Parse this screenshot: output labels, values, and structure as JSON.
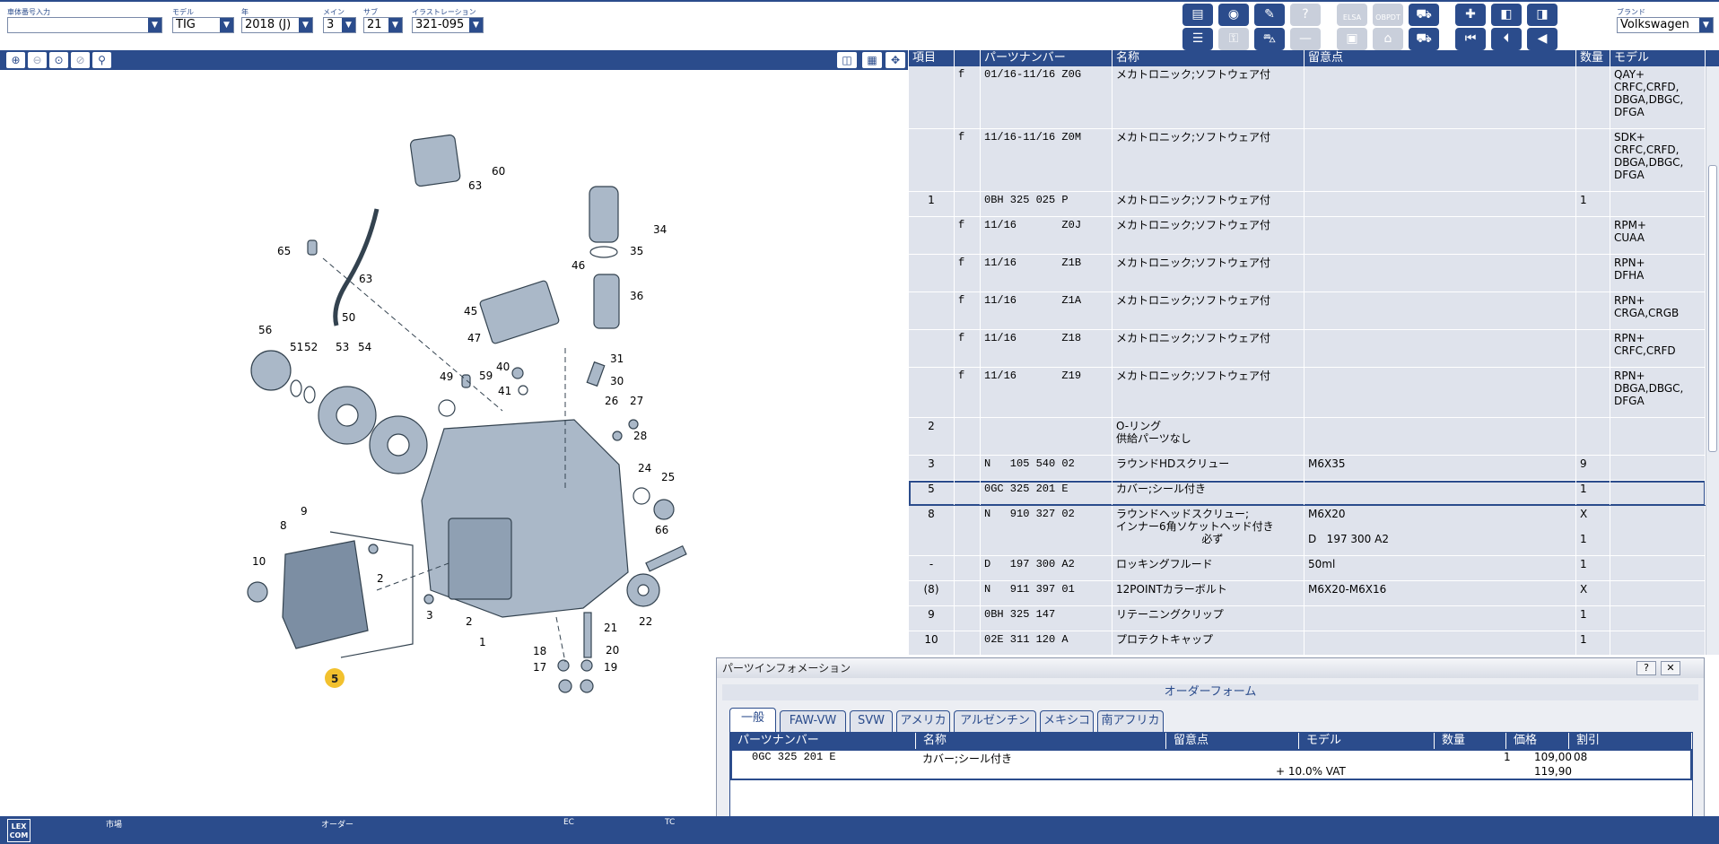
{
  "header": {
    "vin_label": "車体番号入力",
    "vin_value": "",
    "model_label": "モデル",
    "model_value": "TIG",
    "year_label": "年",
    "year_value": "2018 (J)",
    "main_label": "メイン",
    "main_value": "3",
    "sub_label": "サブ",
    "sub_value": "21",
    "illus_label": "イラストレーション",
    "illus_value": "321-095",
    "brand_label": "ブランド",
    "brand_value": "Volkswagen",
    "elsa_label": "ELSA",
    "obdt_label": "OBPDT"
  },
  "parts_table": {
    "columns": [
      "項目",
      "",
      "パーツナンバー",
      "名称",
      "留意点",
      "数量",
      "モデル"
    ],
    "rows": [
      {
        "item": "",
        "flag": "f",
        "part": "01/16-11/16 Z0G",
        "name": "メカトロニック;ソフトウェア付",
        "note": "",
        "qty": "",
        "model": "QAY+\nCRFC,CRFD,\nDBGA,DBGC,\nDFGA"
      },
      {
        "item": "",
        "flag": "f",
        "part": "11/16-11/16 Z0M",
        "name": "メカトロニック;ソフトウェア付",
        "note": "",
        "qty": "",
        "model": "SDK+\nCRFC,CRFD,\nDBGA,DBGC,\nDFGA"
      },
      {
        "item": "1",
        "flag": "",
        "part": "0BH 325 025 P",
        "name": "メカトロニック;ソフトウェア付",
        "note": "",
        "qty": "1",
        "model": ""
      },
      {
        "item": "",
        "flag": "f",
        "part": "11/16       Z0J",
        "name": "メカトロニック;ソフトウェア付",
        "note": "",
        "qty": "",
        "model": "RPM+\nCUAA"
      },
      {
        "item": "",
        "flag": "f",
        "part": "11/16       Z1B",
        "name": "メカトロニック;ソフトウェア付",
        "note": "",
        "qty": "",
        "model": "RPN+\nDFHA"
      },
      {
        "item": "",
        "flag": "f",
        "part": "11/16       Z1A",
        "name": "メカトロニック;ソフトウェア付",
        "note": "",
        "qty": "",
        "model": "RPN+\nCRGA,CRGB"
      },
      {
        "item": "",
        "flag": "f",
        "part": "11/16       Z18",
        "name": "メカトロニック;ソフトウェア付",
        "note": "",
        "qty": "",
        "model": "RPN+\nCRFC,CRFD"
      },
      {
        "item": "",
        "flag": "f",
        "part": "11/16       Z19",
        "name": "メカトロニック;ソフトウェア付",
        "note": "",
        "qty": "",
        "model": "RPN+\nDBGA,DBGC,\nDFGA"
      },
      {
        "item": "2",
        "flag": "",
        "part": "",
        "name": "O-リング\n供給パーツなし",
        "note": "",
        "qty": "",
        "model": ""
      },
      {
        "item": "3",
        "flag": "",
        "part": "N   105 540 02",
        "name": "ラウンドHDスクリュー",
        "note": "M6X35",
        "qty": "9",
        "model": ""
      },
      {
        "item": "5",
        "flag": "",
        "part": "0GC 325 201 E",
        "name": "カバー;シール付き",
        "note": "",
        "qty": "1",
        "model": ""
      },
      {
        "item": "8",
        "flag": "",
        "part": "N   910 327 02",
        "name": "ラウンドヘッドスクリュー;\nインナー6角ソケットヘッド付き\n                         必ず",
        "note": "M6X20\n\nD   197 300 A2",
        "qty": "X\n\n1",
        "model": ""
      },
      {
        "item": "-",
        "flag": "",
        "part": "D   197 300 A2",
        "name": "ロッキングフルード",
        "note": "50ml",
        "qty": "1",
        "model": ""
      },
      {
        "item": "(8)",
        "flag": "",
        "part": "N   911 397 01",
        "name": "12POINTカラーボルト",
        "note": "M6X20-M6X16",
        "qty": "X",
        "model": ""
      },
      {
        "item": "9",
        "flag": "",
        "part": "0BH 325 147",
        "name": "リテーニングクリップ",
        "note": "",
        "qty": "1",
        "model": ""
      },
      {
        "item": "10",
        "flag": "",
        "part": "02E 311 120 A",
        "name": "プロテクトキャップ",
        "note": "",
        "qty": "1",
        "model": ""
      }
    ]
  },
  "diagram": {
    "labels": [
      "60",
      "63",
      "65",
      "63",
      "34",
      "35",
      "36",
      "46",
      "45",
      "47",
      "56",
      "50",
      "51",
      "52",
      "53",
      "54",
      "49",
      "59",
      "40",
      "41",
      "31",
      "30",
      "26",
      "27",
      "28",
      "24",
      "25",
      "9",
      "8",
      "10",
      "2",
      "3",
      "66",
      "2",
      "1",
      "21",
      "22",
      "18",
      "20",
      "17",
      "19",
      "5"
    ],
    "selected_callout": "5"
  },
  "part_info": {
    "title": "パーツインフォメーション",
    "help": "?",
    "close": "✕",
    "form_title": "オーダーフォーム",
    "tabs": [
      "一般",
      "FAW-VW",
      "SVW",
      "アメリカ",
      "アルゼンチン",
      "メキシコ",
      "南アフリカ"
    ],
    "columns": [
      "パーツナンバー",
      "名称",
      "留意点",
      "モデル",
      "数量",
      "価格",
      "割引"
    ],
    "row": {
      "part": "0GC 325 201 E",
      "name": "カバー;シール付き",
      "vat": "+ 10.0% VAT",
      "qty": "1",
      "price": "109,00",
      "price_vat": "119,90",
      "discount": "08"
    }
  },
  "footer": {
    "logo": "LEX\nCOM",
    "market": "市場",
    "order": "オーダー",
    "ec": "EC",
    "tc": "TC"
  },
  "colors": {
    "accent": "#2b4c8c",
    "row_bg": "#dfe3ec",
    "callout": "#f2c12e"
  }
}
